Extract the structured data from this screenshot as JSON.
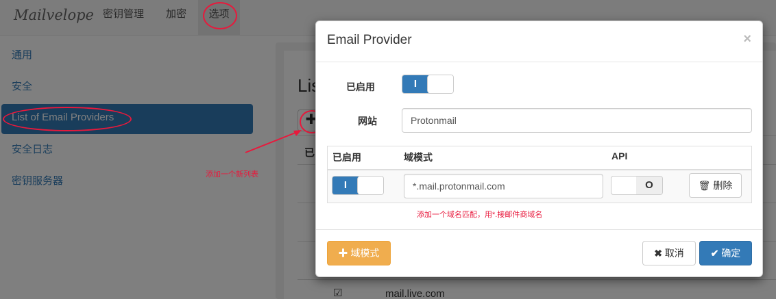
{
  "app": {
    "brand": "Mailvelope",
    "nav": [
      "密钥管理",
      "加密",
      "选项"
    ]
  },
  "sidebar": {
    "items": [
      "通用",
      "安全",
      "List of Email Providers",
      "安全日志",
      "密钥服务器"
    ]
  },
  "background": {
    "title": "Lis",
    "table_header": "已",
    "row_domain": "mail.live.com"
  },
  "modal": {
    "title": "Email Provider",
    "close": "×",
    "enabled_label": "已启用",
    "enabled_on": "I",
    "site_label": "网站",
    "site_value": "Protonmail",
    "table": {
      "headers": [
        "已启用",
        "域模式",
        "API"
      ],
      "row": {
        "enabled_on": "I",
        "domain_value": "*.mail.protonmail.com",
        "api_off": "O",
        "delete_label": "删除"
      }
    },
    "help_text": "添加一个域名匹配，用*.接邮件商域名",
    "add_domain_label": "域模式",
    "cancel_label": "取消",
    "confirm_label": "确定"
  },
  "annotations": {
    "arrow_text": "添加一个新列表"
  },
  "colors": {
    "primary": "#337ab7",
    "warning": "#f0ad4e",
    "annotation": "#e8193c"
  }
}
